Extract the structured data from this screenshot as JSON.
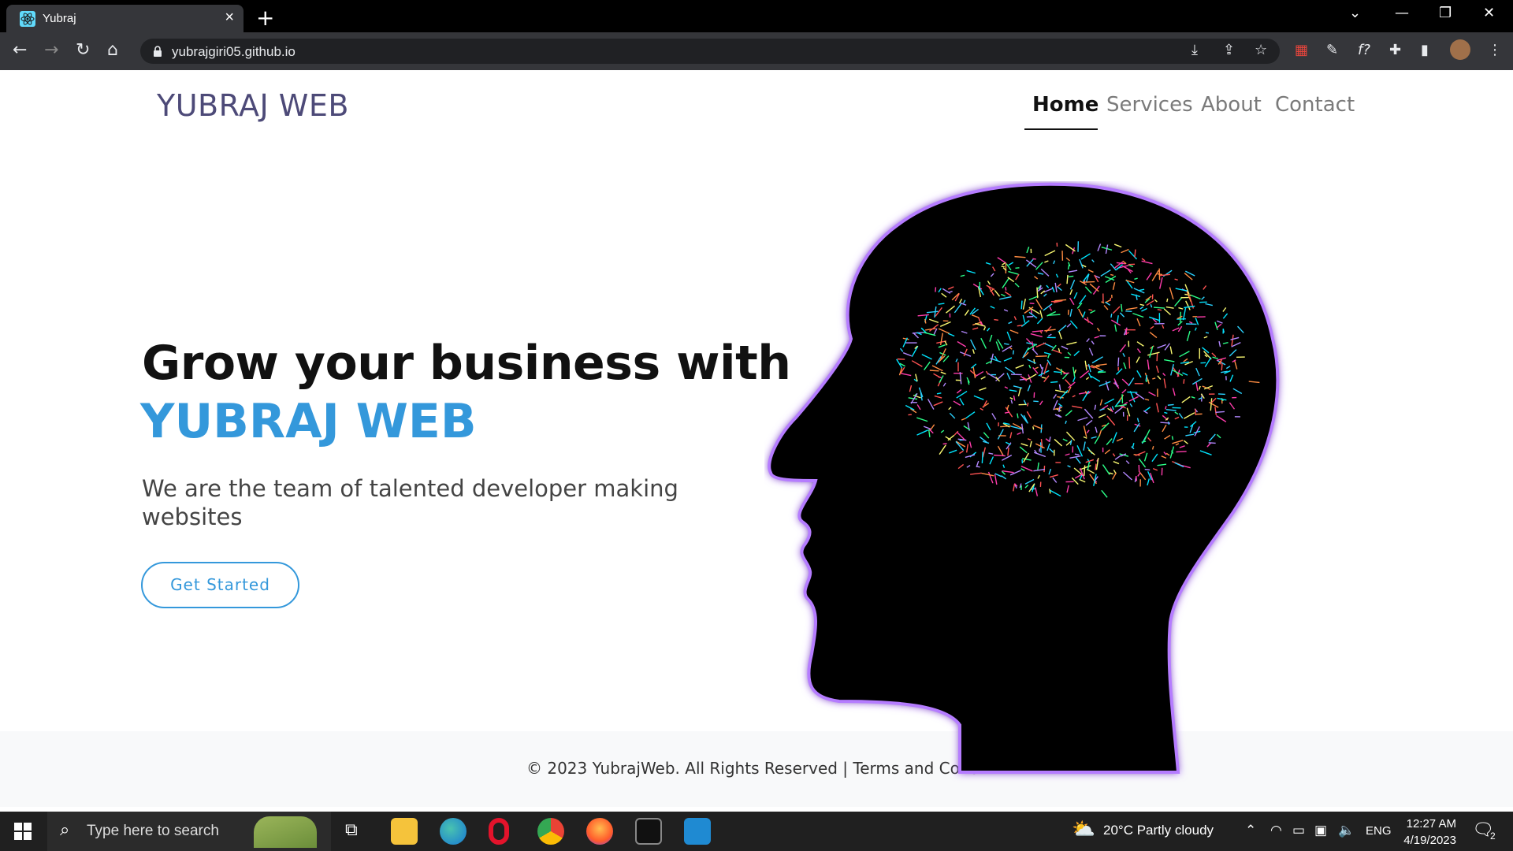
{
  "browser": {
    "tab_title": "Yubraj",
    "url": "yubrajgiri05.github.io"
  },
  "site": {
    "brand": "YUBRAJ WEB",
    "nav": [
      "Home",
      "Services",
      "About",
      "Contact"
    ],
    "active_nav": "Home",
    "hero": {
      "line1": "Grow your business with",
      "line2": "YUBRAJ WEB",
      "subtitle": "We are the team of talented developer making websites",
      "cta": "Get Started"
    },
    "footer": "© 2023 YubrajWeb. All Rights Reserved | Terms and Conditi"
  },
  "taskbar": {
    "search_placeholder": "Type here to search",
    "weather": "20°C  Partly cloudy",
    "language": "ENG",
    "time": "12:27 AM",
    "date": "4/19/2023",
    "notification_count": "2"
  },
  "colors": {
    "brand": "#4d4a78",
    "accent": "#3498db",
    "chrome_bg": "#35363a"
  }
}
